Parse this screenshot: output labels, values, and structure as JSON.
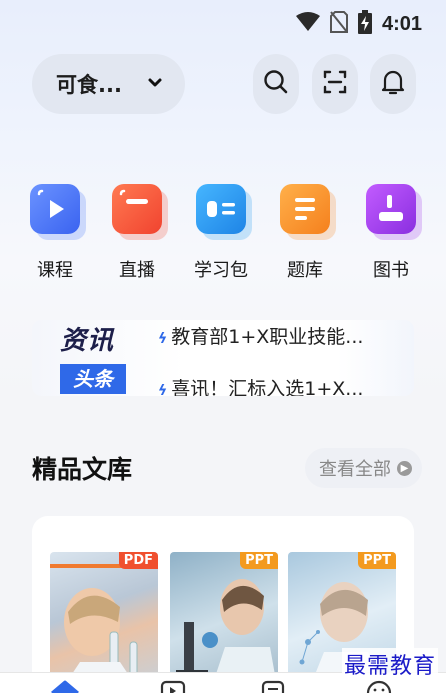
{
  "status_bar": {
    "time": "4:01",
    "icons": [
      "wifi-icon",
      "no-sim-icon",
      "battery-charging-icon"
    ]
  },
  "header": {
    "org_selector": {
      "label": "可食...",
      "icon": "chevron-down-icon"
    },
    "actions": [
      {
        "name": "search",
        "icon": "search-icon"
      },
      {
        "name": "scan",
        "icon": "scan-icon"
      },
      {
        "name": "notifications",
        "icon": "bell-icon"
      }
    ]
  },
  "categories": [
    {
      "label": "课程",
      "icon": "play-icon",
      "color": "#4f7cf7"
    },
    {
      "label": "直播",
      "icon": "live-icon",
      "color": "#f5553d"
    },
    {
      "label": "学习包",
      "icon": "book-icon",
      "color": "#2d9ef0"
    },
    {
      "label": "题库",
      "icon": "question-bank-icon",
      "color": "#f98a2c"
    },
    {
      "label": "图书",
      "icon": "book-save-icon",
      "color": "#a23fe6"
    }
  ],
  "news": {
    "brand_top": "资讯",
    "brand_bottom": "头条",
    "items": [
      "教育部1+X职业技能...",
      "喜讯！汇标入选1+X..."
    ]
  },
  "library": {
    "title": "精品文库",
    "see_all": "查看全部",
    "docs": [
      {
        "badge": "PDF",
        "badge_color": "#f0502f"
      },
      {
        "badge": "PPT",
        "badge_color": "#f39a1f"
      },
      {
        "badge": "PPT",
        "badge_color": "#f39a1f"
      }
    ]
  },
  "tabbar": {
    "tabs": [
      "home-icon",
      "play-icon",
      "document-icon",
      "profile-icon"
    ]
  },
  "watermark": "最需教育"
}
